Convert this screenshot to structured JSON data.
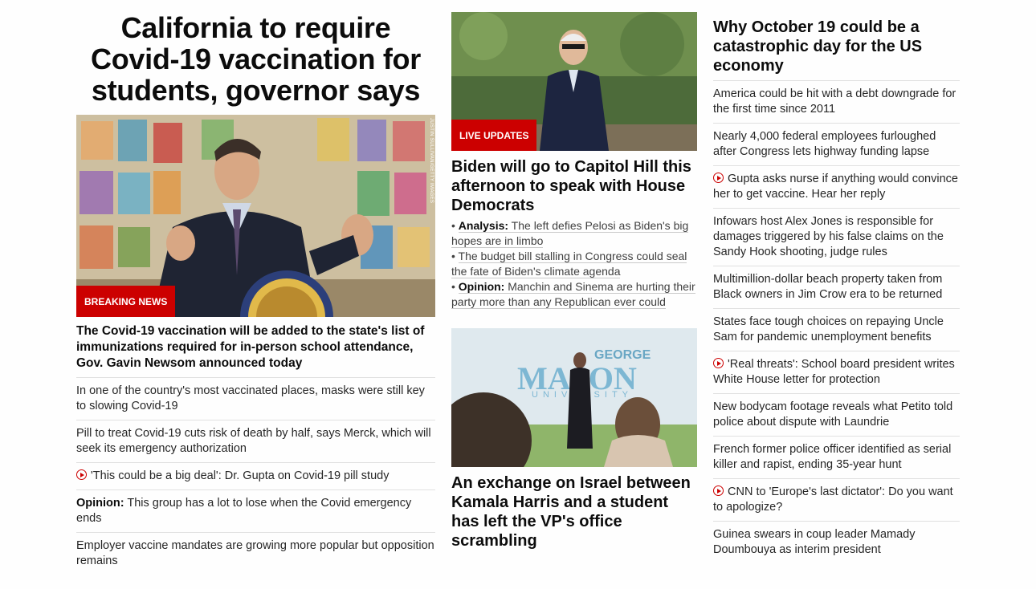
{
  "main": {
    "headline": "California to require Covid-19 vaccination for students, governor says",
    "badge": "BREAKING NEWS",
    "photo_credit": "JUSTIN SULLIVAN/GETTY IMAGES",
    "lead_text": "The Covid-19 vaccination will be added to the state's list of immunizations required for in-person school attendance, Gov. Gavin Newsom announced today",
    "stories": [
      {
        "text": "In one of the country's most vaccinated places, masks were still key to slowing Covid-19"
      },
      {
        "text": "Pill to treat Covid-19 cuts risk of death by half, says Merck, which will seek its emergency authorization"
      },
      {
        "text": "'This could be a big deal': Dr. Gupta on Covid-19 pill study",
        "video": true
      },
      {
        "prefix": "Opinion:",
        "text": " This group has a lot to lose when the Covid emergency ends"
      },
      {
        "text": "Employer vaccine mandates are growing more popular but opposition remains"
      }
    ]
  },
  "middle": {
    "live_badge": "LIVE UPDATES",
    "headline1": "Biden will go to Capitol Hill this afternoon to speak with House Democrats",
    "bullets": [
      {
        "prefix": "Analysis:",
        "text": " The left defies Pelosi as Biden's big hopes are in limbo"
      },
      {
        "prefix": "",
        "text": "The budget bill stalling in Congress could seal the fate of Biden's climate agenda"
      },
      {
        "prefix": "Opinion:",
        "text": " Manchin and Sinema are hurting their party more than any Republican ever could"
      }
    ],
    "headline2": "An exchange on Israel between Kamala Harris and a student has left the VP's office scrambling",
    "sign_line1": "GEORGE",
    "sign_line2": "MASON",
    "sign_line3": "UNIVERSITY"
  },
  "right": {
    "headline": "Why October 19 could be a catastrophic day for the US economy",
    "stories": [
      {
        "text": "America could be hit with a debt downgrade for the first time since 2011"
      },
      {
        "text": "Nearly 4,000 federal employees furloughed after Congress lets highway funding lapse"
      },
      {
        "text": "Gupta asks nurse if anything would convince her to get vaccine. Hear her reply",
        "video": true
      },
      {
        "text": "Infowars host Alex Jones is responsible for damages triggered by his false claims on the Sandy Hook shooting, judge rules"
      },
      {
        "text": "Multimillion-dollar beach property taken from Black owners in Jim Crow era to be returned"
      },
      {
        "text": "States face tough choices on repaying Uncle Sam for pandemic unemployment benefits"
      },
      {
        "text": "'Real threats': School board president writes White House letter for protection",
        "video": true
      },
      {
        "text": "New bodycam footage reveals what Petito told police about dispute with Laundrie"
      },
      {
        "text": "French former police officer identified as serial killer and rapist, ending 35-year hunt"
      },
      {
        "text": "CNN to 'Europe's last dictator': Do you want to apologize?",
        "video": true
      },
      {
        "text": "Guinea swears in coup leader Mamady Doumbouya as interim president"
      }
    ]
  },
  "colors": {
    "accent": "#cc0000",
    "divider": "#e0e0e0"
  },
  "icons": {
    "video": "play-circle-icon"
  }
}
